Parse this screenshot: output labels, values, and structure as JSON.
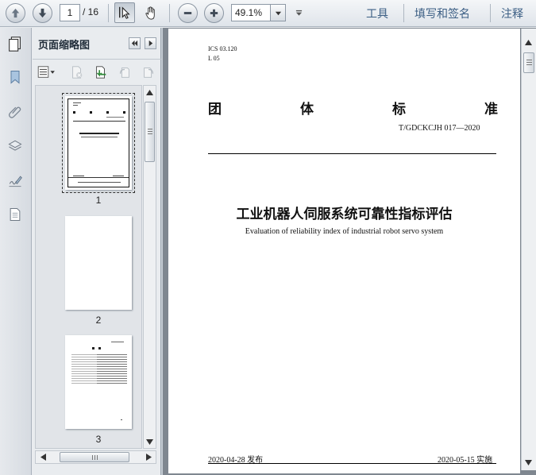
{
  "toolbar": {
    "current_page": "1",
    "total_pages": "/ 16",
    "zoom": "49.1%",
    "menu_tools": "工具",
    "menu_fill_sign": "填写和签名",
    "menu_comment": "注释"
  },
  "thumbnails": {
    "title": "页面缩略图",
    "pages": [
      "1",
      "2",
      "3"
    ]
  },
  "document": {
    "ics_line1": "ICS 03.120",
    "ics_line2": "L 05",
    "std_type_chars": [
      "团",
      "体",
      "标",
      "准"
    ],
    "std_code": "T/GDCKCJH 017—2020",
    "title_cn": "工业机器人伺服系统可靠性指标评估",
    "title_en": "Evaluation of reliability index of industrial robot servo system",
    "publish_date": "2020-04-28 发布",
    "implement_date": "2020-05-15 实施"
  },
  "colors": {
    "menu_text": "#3b5e84",
    "viewer_background": "#7f8790"
  }
}
